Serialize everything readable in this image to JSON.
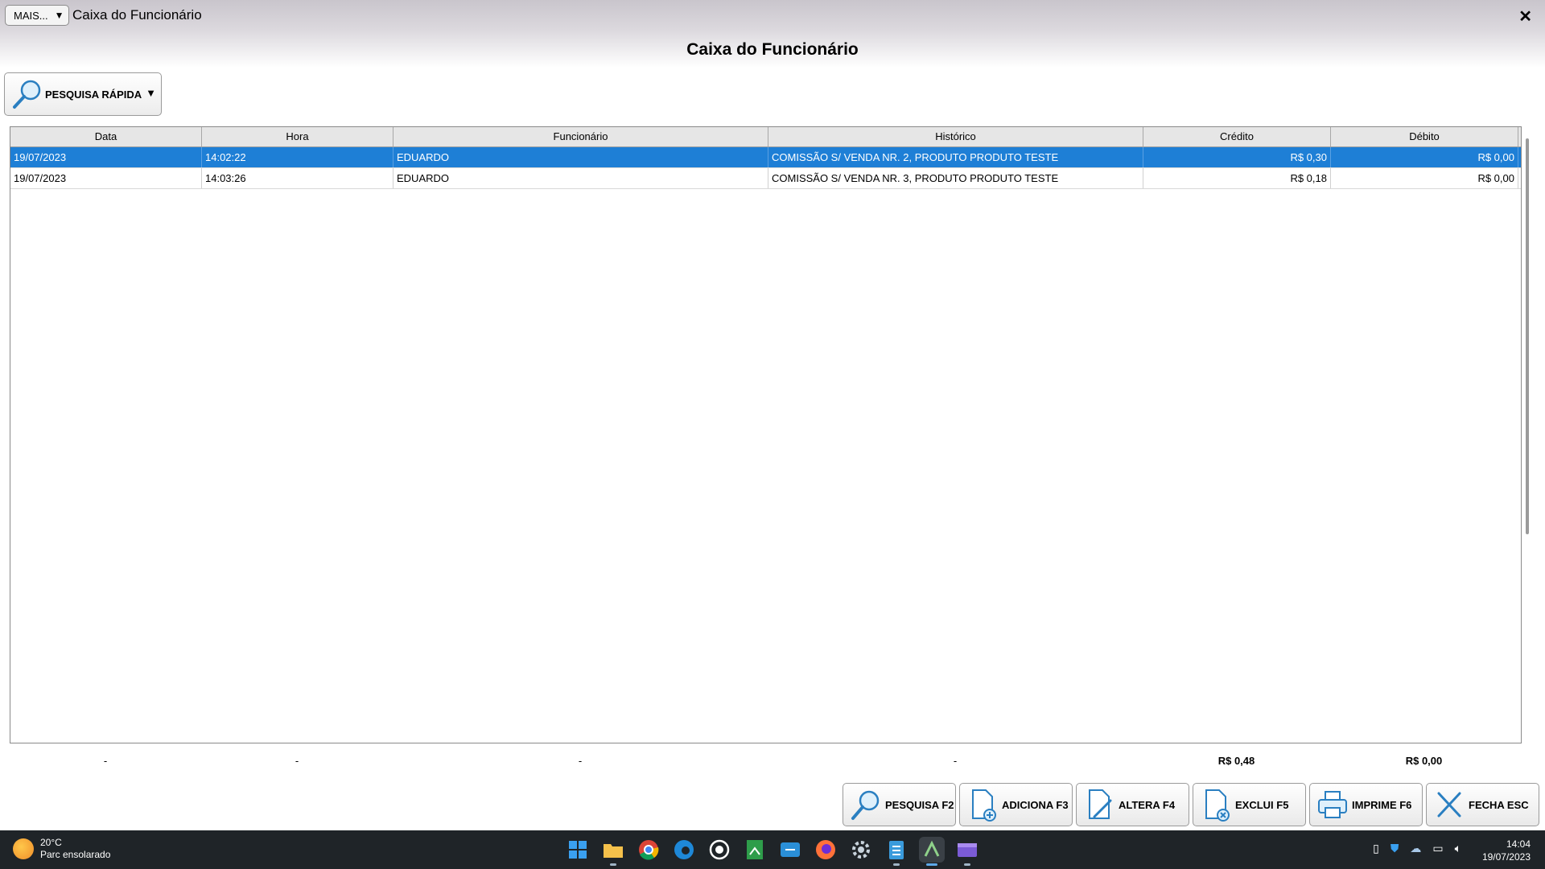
{
  "titlebar": {
    "menu_button": "MAIS...",
    "menu_arrow": "▼",
    "title": "Caixa do Funcionário",
    "close": "✕"
  },
  "page_title": "Caixa do Funcionário",
  "quick_search": {
    "label": "PESQUISA RÁPIDA",
    "arrow": "▼"
  },
  "table": {
    "columns": [
      "Data",
      "Hora",
      "Funcionário",
      "Histórico",
      "Crédito",
      "Débito"
    ],
    "rows": [
      {
        "data": "19/07/2023",
        "hora": "14:02:22",
        "funcionario": "EDUARDO",
        "historico": "COMISSÃO S/ VENDA NR. 2, PRODUTO PRODUTO TESTE",
        "credito": "R$ 0,30",
        "debito": "R$ 0,00"
      },
      {
        "data": "19/07/2023",
        "hora": "14:03:26",
        "funcionario": "EDUARDO",
        "historico": "COMISSÃO S/ VENDA NR. 3, PRODUTO PRODUTO TESTE",
        "credito": "R$ 0,18",
        "debito": "R$ 0,00"
      }
    ],
    "selected_row": 0,
    "selection_color": "#1e7fd6"
  },
  "totals": [
    "-",
    "-",
    "-",
    "-",
    "R$ 0,48",
    "R$ 0,00"
  ],
  "buttons": [
    {
      "label": "PESQUISA F2",
      "icon": "search-icon"
    },
    {
      "label": "ADICIONA F3",
      "icon": "add-document-icon"
    },
    {
      "label": "ALTERA F4",
      "icon": "edit-document-icon"
    },
    {
      "label": "EXCLUI F5",
      "icon": "delete-document-icon"
    },
    {
      "label": "IMPRIME F6",
      "icon": "printer-icon"
    },
    {
      "label": "FECHA ESC",
      "icon": "close-icon"
    }
  ],
  "taskbar": {
    "weather_temp": "20°C",
    "weather_desc": "Parc ensolarado",
    "time": "14:04",
    "date": "19/07/2023"
  }
}
